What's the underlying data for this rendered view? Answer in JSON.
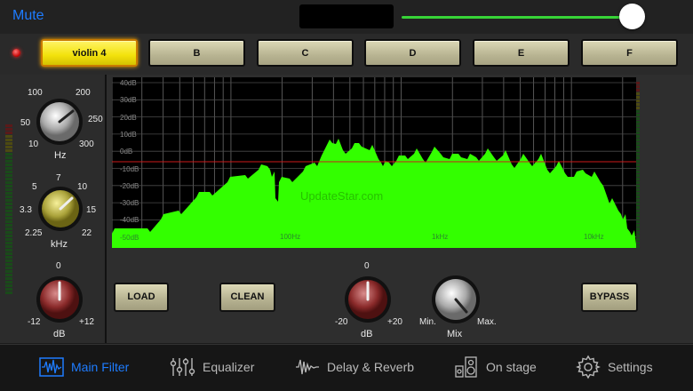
{
  "topbar": {
    "mute_label": "Mute",
    "volume_level": 0.95
  },
  "presets": {
    "items": [
      "violin 4",
      "B",
      "C",
      "D",
      "E",
      "F"
    ],
    "active_index": 0
  },
  "knobs": {
    "hz": {
      "label": "Hz",
      "scale": [
        "10",
        "50",
        "100",
        "200",
        "250",
        "300"
      ]
    },
    "khz": {
      "label": "kHz",
      "scale": [
        "2.25",
        "3.3",
        "5",
        "7",
        "10",
        "15",
        "22"
      ]
    },
    "gain_left": {
      "label": "dB",
      "scale": [
        "-12",
        "0",
        "+12"
      ]
    },
    "gain_mid": {
      "label": "dB",
      "scale": [
        "-20",
        "0",
        "+20"
      ]
    },
    "mix": {
      "label": "Mix",
      "scale": [
        "Min.",
        "Max."
      ]
    }
  },
  "buttons": {
    "load": "LOAD",
    "clean": "CLEAN",
    "bypass": "BYPASS"
  },
  "spectrum": {
    "db_labels": [
      "40dB",
      "30dB",
      "20dB",
      "10dB",
      "0dB",
      "-10dB",
      "-20dB",
      "-30dB",
      "-40dB",
      "-50dB"
    ],
    "freq_labels": [
      "100Hz",
      "1kHz",
      "10kHz"
    ],
    "watermark": "UpdateStar.com",
    "colors": {
      "fill": "#33ff00",
      "line": "#cc1a1a"
    }
  },
  "tabs": [
    {
      "label": "Main Filter",
      "icon": "waveform-icon"
    },
    {
      "label": "Equalizer",
      "icon": "equalizer-sliders-icon"
    },
    {
      "label": "Delay & Reverb",
      "icon": "reverb-wave-icon"
    },
    {
      "label": "On stage",
      "icon": "stage-speaker-icon"
    },
    {
      "label": "Settings",
      "icon": "gear-icon"
    }
  ],
  "active_tab": 0
}
